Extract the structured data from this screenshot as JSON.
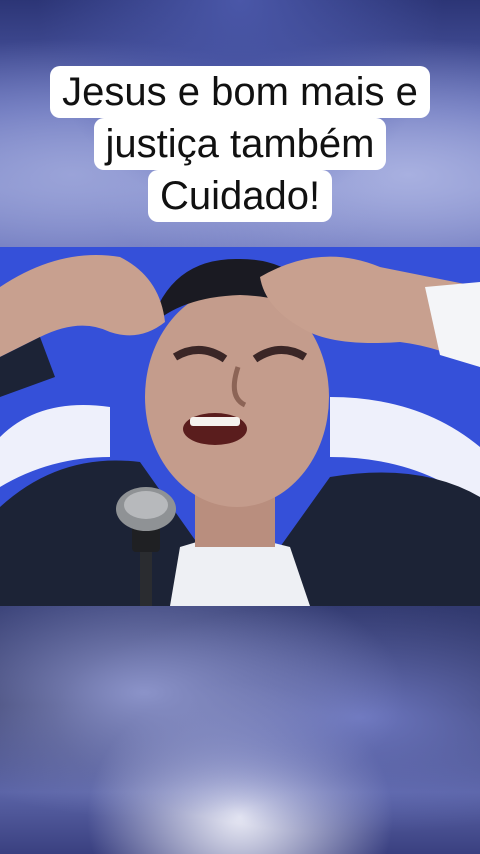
{
  "caption": {
    "lines": [
      "Jesus e bom mais e",
      "justiça também",
      "Cuidado!"
    ]
  },
  "scene": {
    "subject": "preacher-with-raised-hands",
    "colors": {
      "stage_blue": "#3a55dd",
      "suit": "#1c2336",
      "skin": "#c7a090",
      "shirt": "#f2f2f4",
      "mic": "#8f9295"
    }
  }
}
